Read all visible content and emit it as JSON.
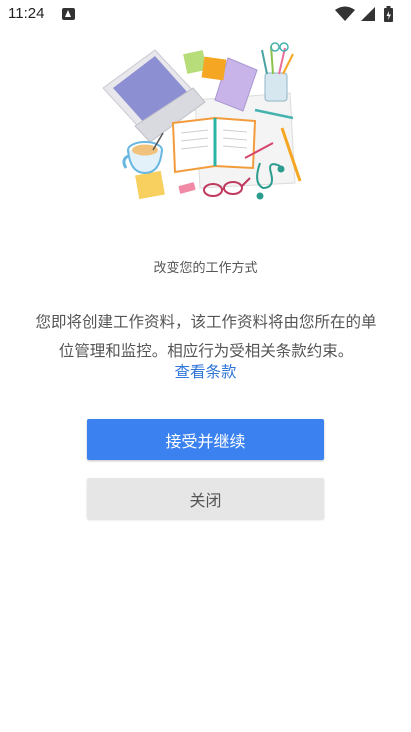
{
  "status_bar": {
    "time": "11:24",
    "icons": [
      "app-notification-icon",
      "wifi-icon",
      "signal-icon",
      "battery-icon"
    ]
  },
  "illustration": {
    "icon": "workspace-illustration"
  },
  "content": {
    "subtitle": "改变您的工作方式",
    "description": "您即将创建工作资料，该工作资料将由您所在的单位管理和监控。相应行为受相关条款约束。",
    "terms_link": "查看条款"
  },
  "actions": {
    "accept_label": "接受并继续",
    "close_label": "关闭"
  },
  "colors": {
    "accent": "#3b82f0",
    "link": "#2f76d8",
    "secondary_button": "#e6e6e6"
  }
}
